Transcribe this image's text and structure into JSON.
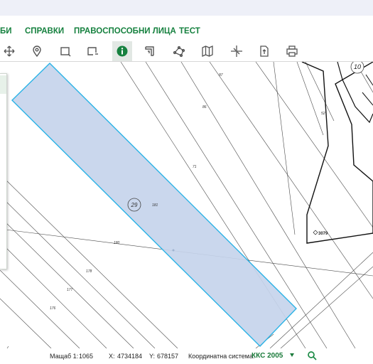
{
  "menu": {
    "items": [
      {
        "label": "БИ"
      },
      {
        "label": "СПРАВКИ"
      },
      {
        "label": "ПРАВОСПОСОБНИ ЛИЦА"
      },
      {
        "label": "ТЕСТ"
      }
    ]
  },
  "toolbar": {
    "tools": [
      {
        "icon": "pan-icon"
      },
      {
        "icon": "location-pin-icon"
      },
      {
        "icon": "select-rectangle-icon"
      },
      {
        "icon": "select-area-icon"
      },
      {
        "icon": "info-icon",
        "active": true
      },
      {
        "icon": "measure-area-icon"
      },
      {
        "icon": "draw-polygon-icon"
      },
      {
        "icon": "map-icon"
      },
      {
        "icon": "coordinates-icon"
      },
      {
        "icon": "export-icon"
      },
      {
        "icon": "print-icon"
      }
    ]
  },
  "map": {
    "parcel_number": "29",
    "block_badge": "10",
    "labels": {
      "l87": "87",
      "l86": "86",
      "l71": "71",
      "l52": "52",
      "l181": "181",
      "l180": "180",
      "l178": "178",
      "l177": "177",
      "l176": "176",
      "l3079": "3079"
    },
    "colors": {
      "selection_fill": "#c5d4ec",
      "selection_stroke": "#2bb3e6",
      "accent": "#16813f"
    }
  },
  "status": {
    "scale_label": "Мащаб 1:",
    "scale_value": "1065",
    "x_label": "X:",
    "x_value": "4734184",
    "y_label": "Y:",
    "y_value": "678157",
    "crs_label": "Координатна система:",
    "crs_value": "ККС 2005"
  }
}
